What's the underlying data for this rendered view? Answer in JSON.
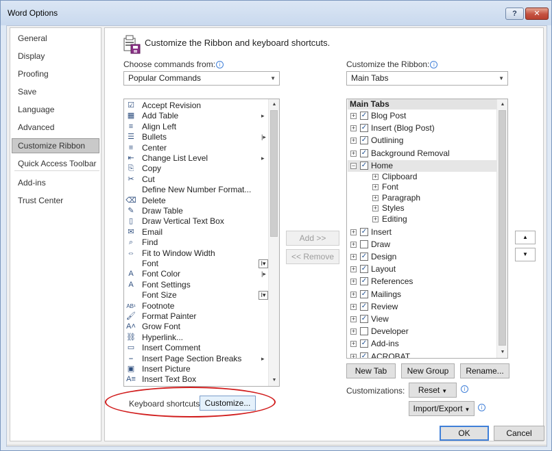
{
  "window": {
    "title": "Word Options",
    "help_label": "?",
    "close_label": "✕"
  },
  "sidebar": {
    "items": [
      {
        "label": "General"
      },
      {
        "label": "Display"
      },
      {
        "label": "Proofing"
      },
      {
        "label": "Save"
      },
      {
        "label": "Language"
      },
      {
        "label": "Advanced"
      },
      {
        "label": "Customize Ribbon",
        "selected": true
      },
      {
        "label": "Quick Access Toolbar"
      },
      {
        "label": "Add-ins"
      },
      {
        "label": "Trust Center"
      }
    ]
  },
  "header": {
    "title": "Customize the Ribbon and keyboard shortcuts."
  },
  "left": {
    "choose_label": "Choose commands from:",
    "choose_value": "Popular Commands",
    "commands": [
      {
        "label": "Accept Revision",
        "icon": "accept-revision-icon",
        "glyph": "☑"
      },
      {
        "label": "Add Table",
        "icon": "table-icon",
        "glyph": "▦",
        "submenu": true
      },
      {
        "label": "Align Left",
        "icon": "align-left-icon",
        "glyph": "≡"
      },
      {
        "label": "Bullets",
        "icon": "bullets-icon",
        "glyph": "☰",
        "split": true
      },
      {
        "label": "Center",
        "icon": "align-center-icon",
        "glyph": "≡"
      },
      {
        "label": "Change List Level",
        "icon": "list-level-icon",
        "glyph": "⇤",
        "submenu": true
      },
      {
        "label": "Copy",
        "icon": "copy-icon",
        "glyph": "⎘"
      },
      {
        "label": "Cut",
        "icon": "scissors-icon",
        "glyph": "✂"
      },
      {
        "label": "Define New Number Format...",
        "icon": "",
        "glyph": ""
      },
      {
        "label": "Delete",
        "icon": "delete-icon",
        "glyph": "⌫"
      },
      {
        "label": "Draw Table",
        "icon": "draw-table-icon",
        "glyph": "✎"
      },
      {
        "label": "Draw Vertical Text Box",
        "icon": "text-box-icon",
        "glyph": "▯"
      },
      {
        "label": "Email",
        "icon": "email-icon",
        "glyph": "✉"
      },
      {
        "label": "Find",
        "icon": "find-icon",
        "glyph": "⌕"
      },
      {
        "label": "Fit to Window Width",
        "icon": "fit-width-icon",
        "glyph": "⇔"
      },
      {
        "label": "Font",
        "icon": "",
        "glyph": "",
        "box": "I▾"
      },
      {
        "label": "Font Color",
        "icon": "font-color-icon",
        "glyph": "A",
        "split": true
      },
      {
        "label": "Font Settings",
        "icon": "font-settings-icon",
        "glyph": "A"
      },
      {
        "label": "Font Size",
        "icon": "",
        "glyph": "",
        "box": "I▾"
      },
      {
        "label": "Footnote",
        "icon": "footnote-icon",
        "glyph": "AB¹"
      },
      {
        "label": "Format Painter",
        "icon": "format-painter-icon",
        "glyph": "🖌"
      },
      {
        "label": "Grow Font",
        "icon": "grow-font-icon",
        "glyph": "A˄"
      },
      {
        "label": "Hyperlink...",
        "icon": "hyperlink-icon",
        "glyph": "⛓"
      },
      {
        "label": "Insert Comment",
        "icon": "comment-icon",
        "glyph": "▭"
      },
      {
        "label": "Insert Page  Section Breaks",
        "icon": "page-break-icon",
        "glyph": "⎯",
        "submenu": true
      },
      {
        "label": "Insert Picture",
        "icon": "picture-icon",
        "glyph": "▣"
      },
      {
        "label": "Insert Text Box",
        "icon": "insert-text-box-icon",
        "glyph": "A≡"
      }
    ],
    "keyboard_label": "Keyboard shortcuts:",
    "customize_button": "Customize..."
  },
  "middle": {
    "add_button": "Add >>",
    "remove_button": "<< Remove"
  },
  "right": {
    "ribbon_label": "Customize the Ribbon:",
    "ribbon_value": "Main Tabs",
    "tree_header": "Main Tabs",
    "tabs": [
      {
        "label": "Blog Post",
        "checked": true,
        "expanded": false
      },
      {
        "label": "Insert (Blog Post)",
        "checked": true,
        "expanded": false
      },
      {
        "label": "Outlining",
        "checked": true,
        "expanded": false
      },
      {
        "label": "Background Removal",
        "checked": true,
        "expanded": false
      },
      {
        "label": "Home",
        "checked": true,
        "expanded": true,
        "highlight": true,
        "groups": [
          "Clipboard",
          "Font",
          "Paragraph",
          "Styles",
          "Editing"
        ]
      },
      {
        "label": "Insert",
        "checked": true,
        "expanded": false
      },
      {
        "label": "Draw",
        "checked": false,
        "expanded": false
      },
      {
        "label": "Design",
        "checked": true,
        "expanded": false
      },
      {
        "label": "Layout",
        "checked": true,
        "expanded": false
      },
      {
        "label": "References",
        "checked": true,
        "expanded": false
      },
      {
        "label": "Mailings",
        "checked": true,
        "expanded": false
      },
      {
        "label": "Review",
        "checked": true,
        "expanded": false
      },
      {
        "label": "View",
        "checked": true,
        "expanded": false
      },
      {
        "label": "Developer",
        "checked": false,
        "expanded": false
      },
      {
        "label": "Add-ins",
        "checked": true,
        "expanded": false
      },
      {
        "label": "ACROBAT",
        "checked": true,
        "expanded": false
      }
    ],
    "new_tab_button": "New Tab",
    "new_group_button": "New Group",
    "rename_button": "Rename...",
    "customizations_label": "Customizations:",
    "reset_button": "Reset",
    "import_export_button": "Import/Export",
    "move_up_label": "▲",
    "move_down_label": "▼"
  },
  "footer": {
    "ok_button": "OK",
    "cancel_button": "Cancel"
  },
  "colors": {
    "annotation_ellipse": "#d11d1d",
    "selected_nav": "#c9c9c9",
    "accent": "#3f7fd8"
  }
}
